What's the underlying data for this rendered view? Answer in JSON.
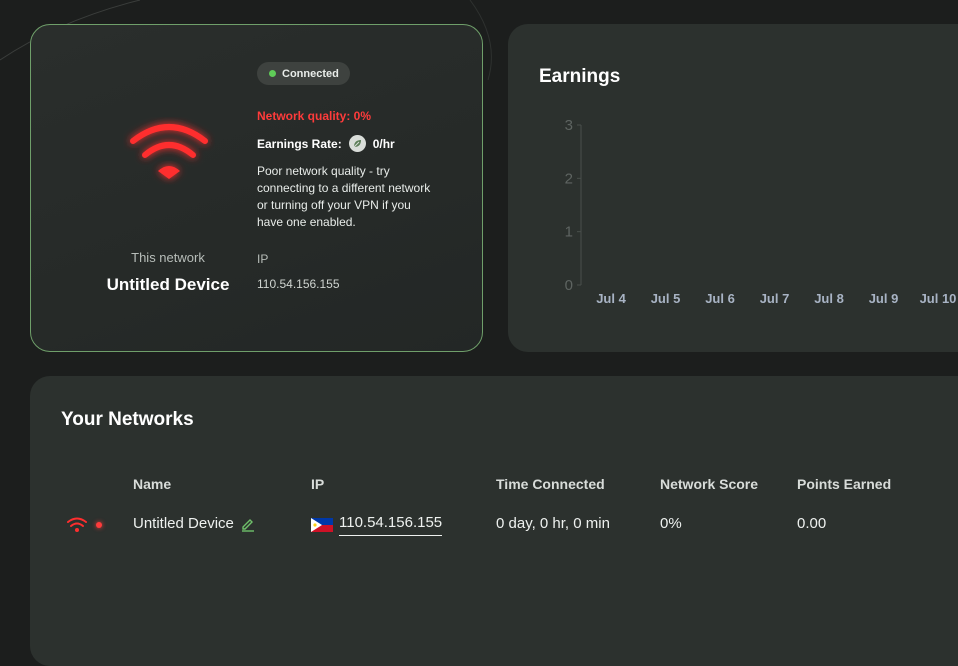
{
  "network_card": {
    "status": "Connected",
    "network_quality": "Network quality: 0%",
    "earnings_rate_label": "Earnings Rate:",
    "earnings_rate_value": "0/hr",
    "warning": "Poor network quality - try connecting to a different network or turning off your VPN if you have one enabled.",
    "this_network_label": "This network",
    "device_name": "Untitled Device",
    "ip_label": "IP",
    "ip_value": "110.54.156.155"
  },
  "earnings": {
    "title": "Earnings",
    "chart_data": {
      "type": "bar",
      "title": "Earnings",
      "xlabel": "",
      "ylabel": "",
      "categories": [
        "Jul 4",
        "Jul 5",
        "Jul 6",
        "Jul 7",
        "Jul 8",
        "Jul 9",
        "Jul 10"
      ],
      "values": [
        0,
        0,
        0,
        0,
        0,
        0,
        0
      ],
      "ylim": [
        0,
        3
      ],
      "yticks": [
        "0",
        "1",
        "2",
        "3"
      ],
      "grid": false,
      "legend": "none"
    }
  },
  "networks": {
    "title": "Your Networks",
    "columns": [
      "Name",
      "IP",
      "Time Connected",
      "Network Score",
      "Points Earned"
    ],
    "rows": [
      {
        "name": "Untitled Device",
        "ip": "110.54.156.155",
        "time_connected": "0 day, 0 hr, 0 min",
        "network_score": "0%",
        "points_earned": "0.00",
        "country_flag": "philippines-flag-icon"
      }
    ]
  },
  "colors": {
    "accent_red": "#ff3b3b",
    "connected_green": "#5fcc58",
    "card_border_green": "#6f9f6a",
    "card_bg": "#2c312e",
    "page_bg": "#1c1e1d"
  }
}
